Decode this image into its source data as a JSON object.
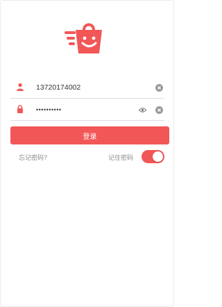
{
  "brand": {
    "accent": "#f25757",
    "logo_icon": "smiling-bag-logo"
  },
  "form": {
    "username": {
      "value": "13720174002",
      "icon": "user-icon"
    },
    "password": {
      "value": "••••••••••",
      "icon": "lock-icon",
      "toggle_icon": "eye-icon"
    },
    "clear_icon": "clear-circle-icon",
    "login_label": "登录"
  },
  "options": {
    "forgot_label": "忘记密码?",
    "remember_label": "记住密码",
    "remember_enabled": true
  }
}
